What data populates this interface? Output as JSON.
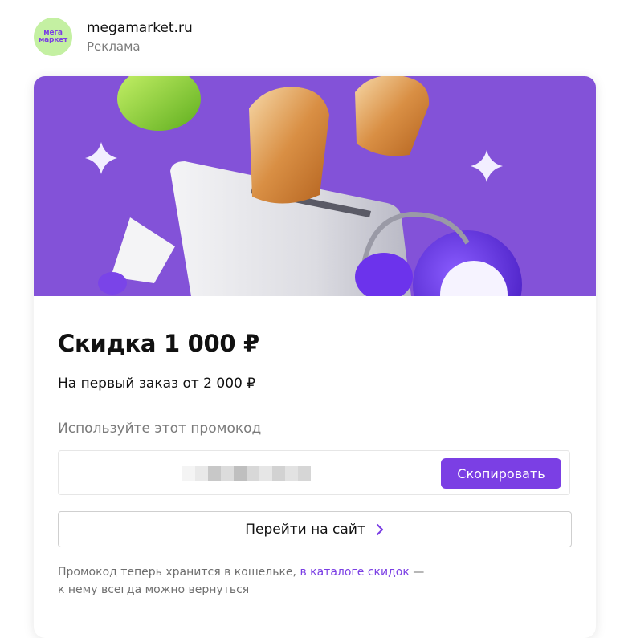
{
  "header": {
    "logo_line1": "мега",
    "logo_line2": "маркет",
    "brand": "megamarket.ru",
    "ad_label": "Реклама"
  },
  "offer": {
    "title": "Скидка 1 000 ₽",
    "subtitle": "На первый заказ от 2 000 ₽",
    "use_code_label": "Используйте этот промокод",
    "copy_button": "Скопировать",
    "site_button": "Перейти на сайт",
    "note_prefix": "Промокод теперь хранится в кошельке, ",
    "note_link": "в каталоге скидок",
    "note_suffix": " —",
    "note_line2": "к нему всегда можно вернуться"
  },
  "colors": {
    "accent": "#7b3fe4",
    "banner_bg": "#8352d8",
    "logo_bg": "#c4f0a2"
  },
  "icons": {
    "chevron": "chevron-right-icon"
  }
}
